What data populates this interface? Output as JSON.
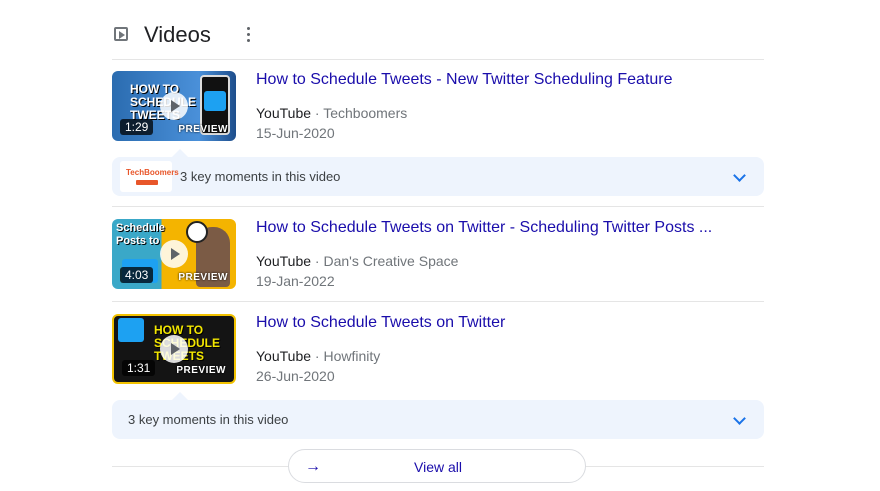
{
  "section": {
    "title": "Videos"
  },
  "videos": [
    {
      "title": "How to Schedule Tweets - New Twitter Scheduling Feature",
      "source": "YouTube",
      "channel": "Techboomers",
      "date": "15-Jun-2020",
      "duration": "1:29",
      "preview": "PREVIEW",
      "thumb_text": "HOW TO SCHEDULE TWEETS"
    },
    {
      "title": "How to Schedule Tweets on Twitter - Scheduling Twitter Posts ...",
      "source": "YouTube",
      "channel": "Dan's Creative Space",
      "date": "19-Jan-2022",
      "duration": "4:03",
      "preview": "PREVIEW",
      "thumb_text": "Schedule Posts to"
    },
    {
      "title": "How to Schedule Tweets on Twitter",
      "source": "YouTube",
      "channel": "Howfinity",
      "date": "26-Jun-2020",
      "duration": "1:31",
      "preview": "PREVIEW",
      "thumb_text": "HOW TO SCHEDULE TWEETS"
    }
  ],
  "key_moments": [
    {
      "label": "3 key moments in this video",
      "logo_text": "TechBoomers"
    },
    {
      "label": "3 key moments in this video"
    }
  ],
  "footer": {
    "view_all": "View all"
  },
  "colors": {
    "link": "#1a0dab",
    "moments_bg": "#eef4fd",
    "accent": "#1a73e8"
  }
}
